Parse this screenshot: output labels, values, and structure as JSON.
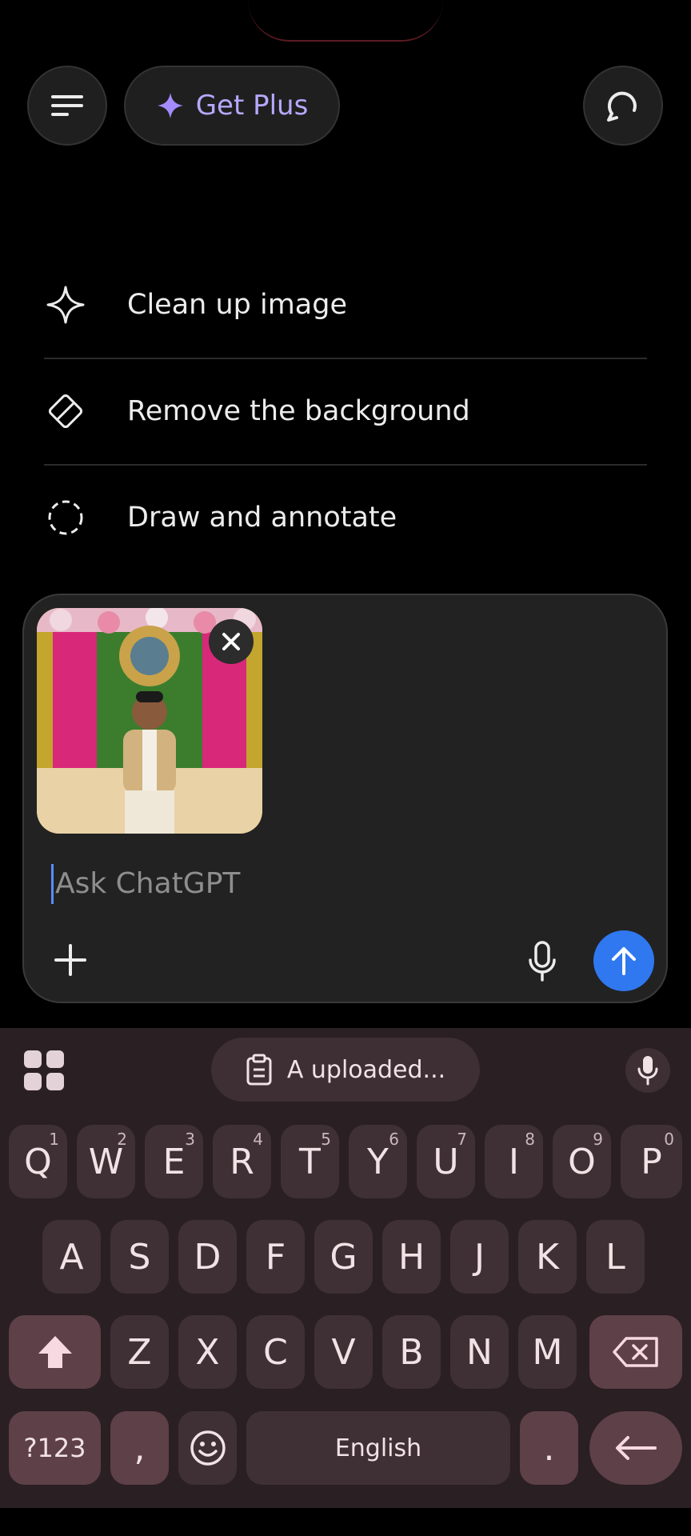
{
  "header": {
    "get_plus_label": "Get Plus",
    "menu_icon": "hamburger-icon",
    "sparkle_icon": "sparkle-icon",
    "new_chat_icon": "chat-refresh-icon",
    "accent_color": "#b7a8ff"
  },
  "suggestions": [
    {
      "label": "Clean up image",
      "icon": "sparkle-outline-icon"
    },
    {
      "label": "Remove the background",
      "icon": "eraser-icon"
    },
    {
      "label": "Draw and annotate",
      "icon": "dashed-circle-icon"
    }
  ],
  "composer": {
    "placeholder": "Ask ChatGPT",
    "attachment": "uploaded photo",
    "send_color": "#2f78f0"
  },
  "keyboard": {
    "clipboard_chip": "A uploaded...",
    "row1": [
      {
        "key": "Q",
        "num": "1"
      },
      {
        "key": "W",
        "num": "2"
      },
      {
        "key": "E",
        "num": "3"
      },
      {
        "key": "R",
        "num": "4"
      },
      {
        "key": "T",
        "num": "5"
      },
      {
        "key": "Y",
        "num": "6"
      },
      {
        "key": "U",
        "num": "7"
      },
      {
        "key": "I",
        "num": "8"
      },
      {
        "key": "O",
        "num": "9"
      },
      {
        "key": "P",
        "num": "0"
      }
    ],
    "row2": [
      "A",
      "S",
      "D",
      "F",
      "G",
      "H",
      "J",
      "K",
      "L"
    ],
    "row3": [
      "Z",
      "X",
      "C",
      "V",
      "B",
      "N",
      "M"
    ],
    "symbols_label": "?123",
    "comma_label": ",",
    "space_label": "English",
    "period_label": "."
  }
}
